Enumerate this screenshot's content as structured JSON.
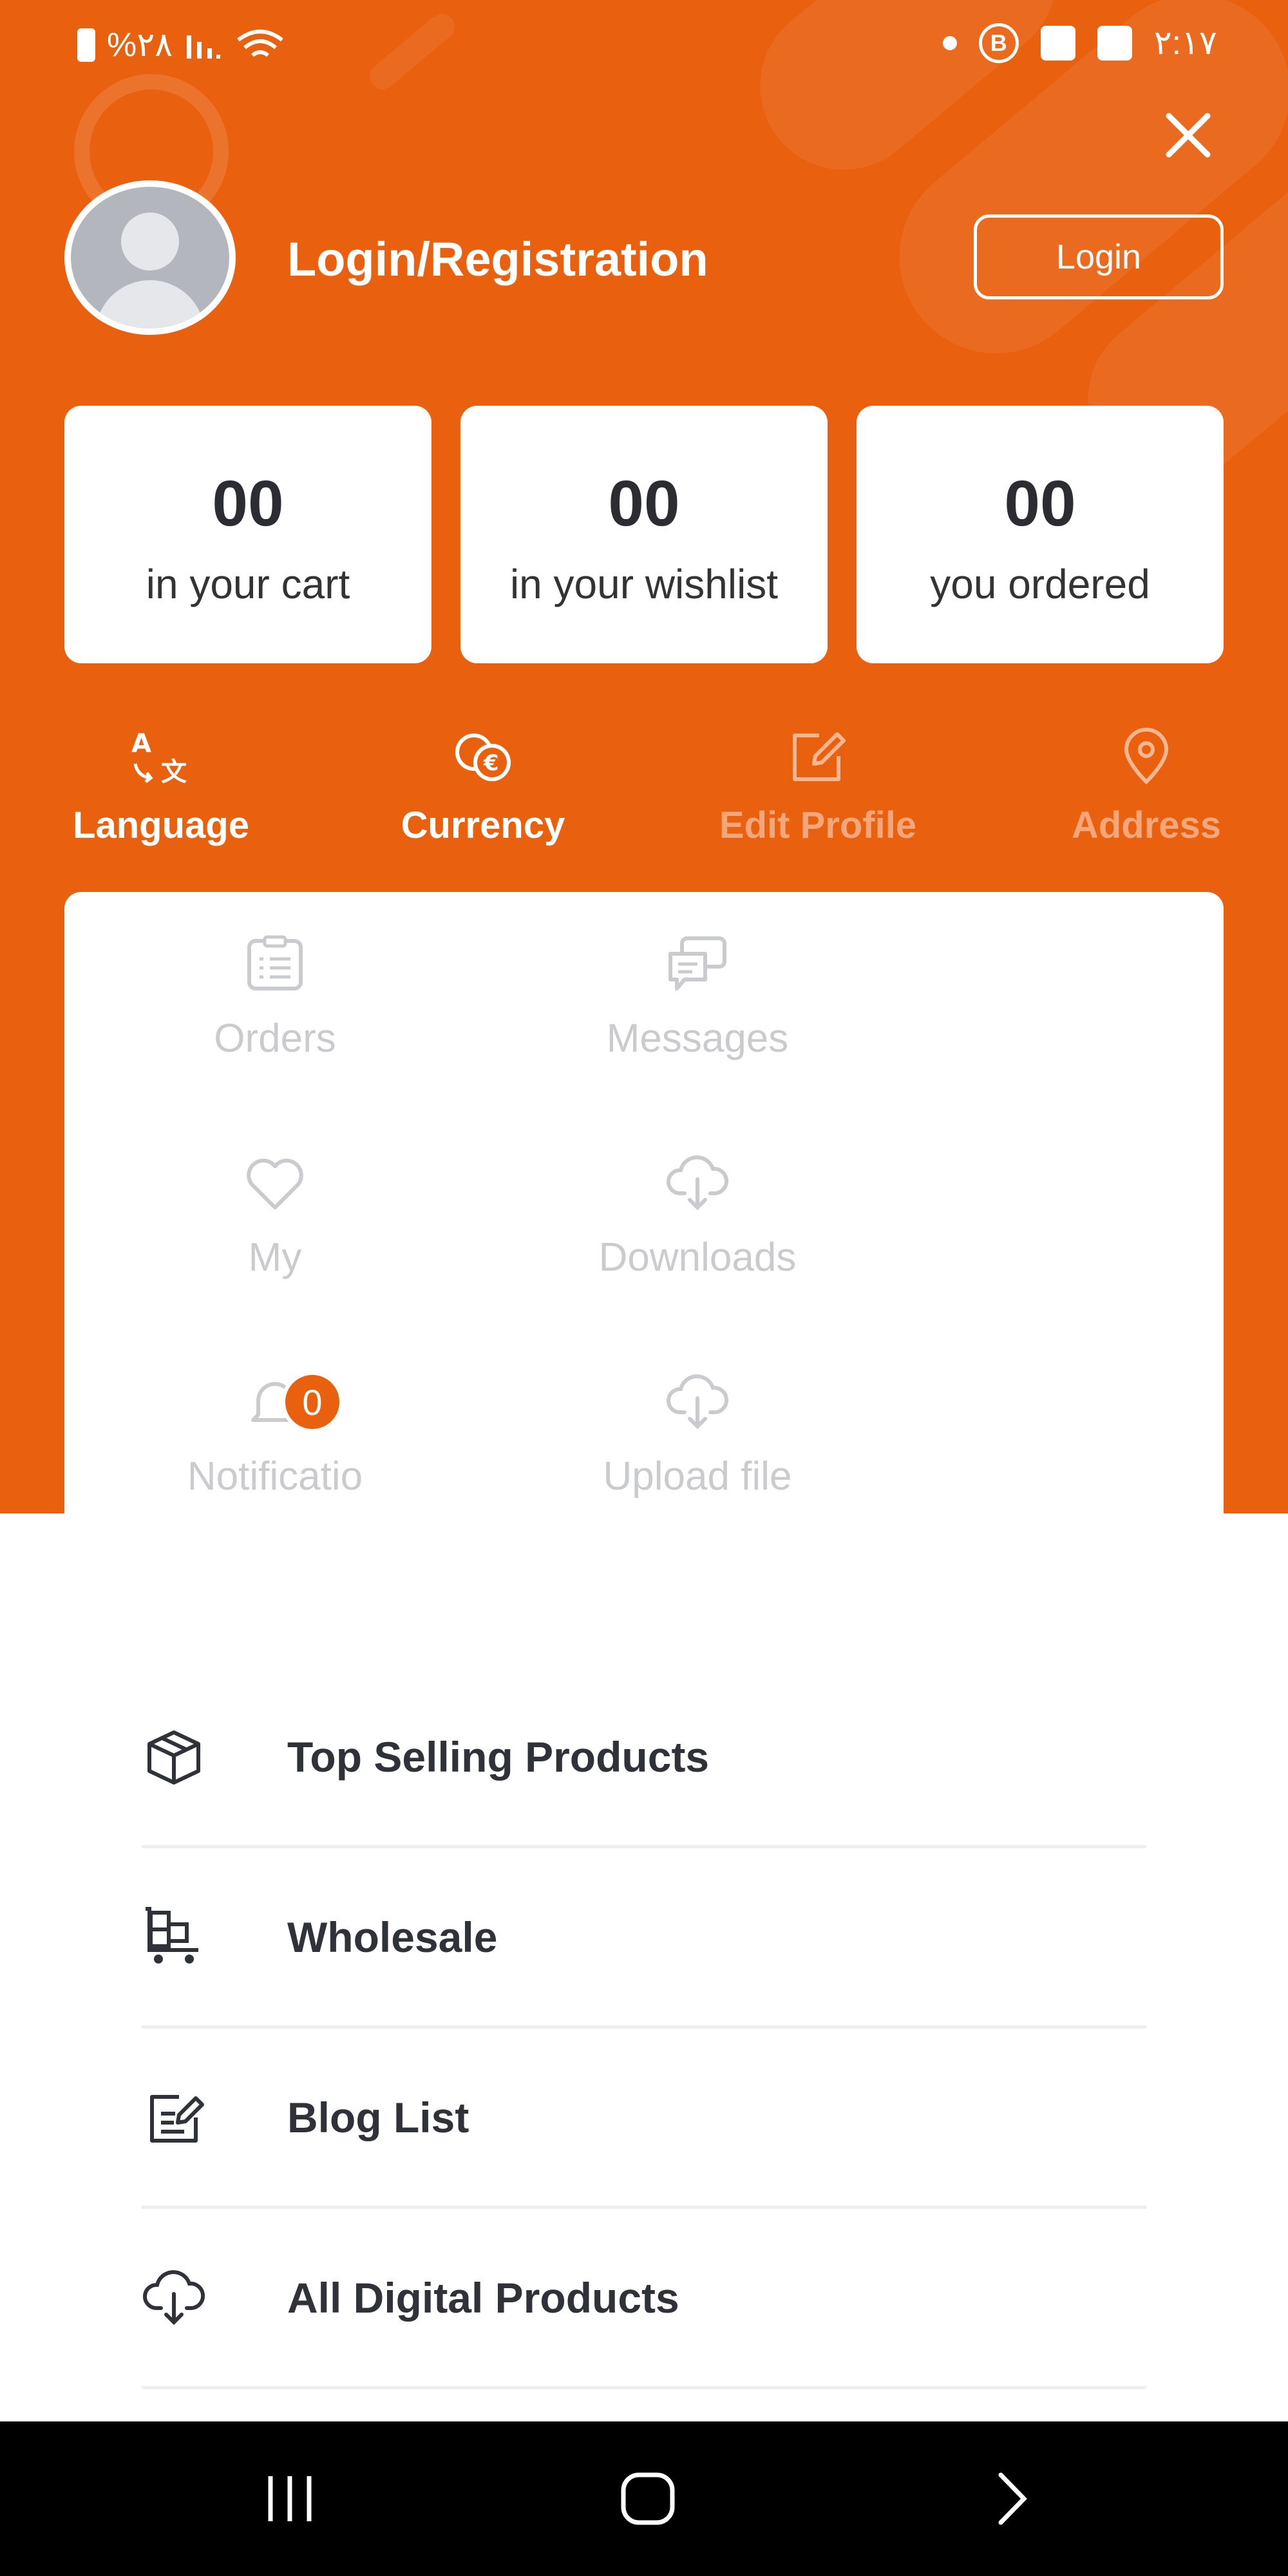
{
  "status_bar": {
    "battery_percent": "%٢٨",
    "time": "٢:١٧"
  },
  "header": {
    "title": "Login/Registration",
    "login_button": "Login"
  },
  "stats": [
    {
      "value": "00",
      "label": "in your cart"
    },
    {
      "value": "00",
      "label": "in your wishlist"
    },
    {
      "value": "00",
      "label": "you ordered"
    }
  ],
  "quick_actions": [
    {
      "label": "Language",
      "icon": "translate-icon"
    },
    {
      "label": "Currency",
      "icon": "currency-exchange-icon"
    },
    {
      "label": "Edit Profile",
      "icon": "edit-icon"
    },
    {
      "label": "Address",
      "icon": "location-pin-icon"
    }
  ],
  "grid": [
    {
      "label": "Orders",
      "icon": "orders-list-icon"
    },
    {
      "label": "Messages",
      "icon": "chat-icon"
    },
    {
      "label": "My",
      "icon": "heart-icon"
    },
    {
      "label": "Downloads",
      "icon": "cloud-download-icon"
    },
    {
      "label": "Notificatio",
      "icon": "bell-icon",
      "badge": "0"
    },
    {
      "label": "Upload file",
      "icon": "cloud-upload-icon"
    }
  ],
  "menu": [
    {
      "label": "Top Selling Products",
      "icon": "box-icon"
    },
    {
      "label": "Wholesale",
      "icon": "wholesale-icon"
    },
    {
      "label": "Blog List",
      "icon": "blog-edit-icon"
    },
    {
      "label": "All Digital Products",
      "icon": "cloud-download-icon"
    }
  ],
  "colors": {
    "accent": "#e9600f",
    "text": "#2f3238",
    "muted": "#c9cbcf"
  }
}
